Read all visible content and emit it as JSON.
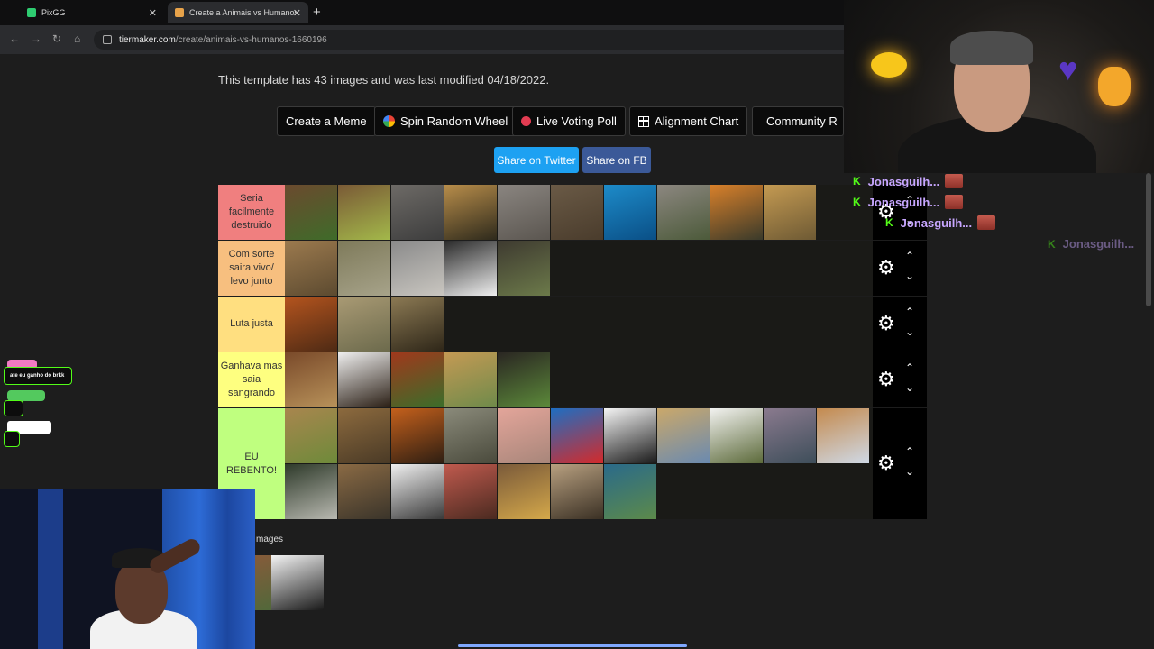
{
  "browser": {
    "tabs": [
      {
        "title": "PixGG",
        "color": "#2ecc71"
      },
      {
        "title": "Create a Animais vs Humanos Tier List",
        "color": "#e8a34a"
      }
    ],
    "url_host": "tiermaker.com",
    "url_path": "/create/animais-vs-humanos-1660196"
  },
  "page": {
    "info_text": "This template has 43 images and was last modified 04/18/2022.",
    "buttons": [
      {
        "label": "Create a Meme"
      },
      {
        "label": "Spin Random Wheel",
        "icon": "wheel-icon"
      },
      {
        "label": "Live Voting Poll",
        "icon": "record-dot-icon"
      },
      {
        "label": "Alignment Chart",
        "icon": "grid-icon"
      },
      {
        "label": "Community R",
        "icon": "community-icon"
      }
    ],
    "share_twitter": "Share on Twitter",
    "share_fb": "Share on FB",
    "tiers": [
      {
        "label": "Seria facilmente destruido",
        "color": "#f07f7f",
        "items": [
          {
            "c1": "#6b4a2e",
            "c2": "#3f6b2a"
          },
          {
            "c1": "#7a5a36",
            "c2": "#a3b84a"
          },
          {
            "c1": "#6d6a66",
            "c2": "#3d3d3d"
          },
          {
            "c1": "#b88d4a",
            "c2": "#2e2a1c"
          },
          {
            "c1": "#8a8580",
            "c2": "#5b5650"
          },
          {
            "c1": "#6a5a46",
            "c2": "#4a3c2c"
          },
          {
            "c1": "#1d8bc9",
            "c2": "#0a4f86"
          },
          {
            "c1": "#8c8780",
            "c2": "#4c5a3a"
          },
          {
            "c1": "#d8802a",
            "c2": "#3a3a2a"
          },
          {
            "c1": "#c49a52",
            "c2": "#6e5a34"
          }
        ]
      },
      {
        "label": "Com sorte saira vivo/ levo junto",
        "color": "#f7bf7f",
        "items": [
          {
            "c1": "#9c7a4e",
            "c2": "#5c4a30"
          },
          {
            "c1": "#7e7a5a",
            "c2": "#a7a38a"
          },
          {
            "c1": "#8a8a8a",
            "c2": "#c9c6c0"
          },
          {
            "c1": "#2a2a2a",
            "c2": "#efefef"
          },
          {
            "c1": "#3e3a30",
            "c2": "#6c7a4a"
          }
        ]
      },
      {
        "label": "Luta justa",
        "color": "#ffdf80",
        "items": [
          {
            "c1": "#b4541e",
            "c2": "#4e2a14"
          },
          {
            "c1": "#a99a74",
            "c2": "#6c6a4c"
          },
          {
            "c1": "#8c7a54",
            "c2": "#2e2618"
          }
        ]
      },
      {
        "label": "Ganhava mas saia sangrando",
        "color": "#feff80",
        "items": [
          {
            "c1": "#7a4a2a",
            "c2": "#b8925a"
          },
          {
            "c1": "#efefef",
            "c2": "#2a1e14"
          },
          {
            "c1": "#a0381c",
            "c2": "#3a6e2a"
          },
          {
            "c1": "#c49a54",
            "c2": "#6e8a4a"
          },
          {
            "c1": "#2a2622",
            "c2": "#5c8a3a"
          }
        ]
      },
      {
        "label": "EU REBENTO!",
        "color": "#bfff7f",
        "items": [
          {
            "c1": "#a8864e",
            "c2": "#6e8a3a"
          },
          {
            "c1": "#8c6a3e",
            "c2": "#4a3a26"
          },
          {
            "c1": "#c4601c",
            "c2": "#2e1e12"
          },
          {
            "c1": "#8a8a7a",
            "c2": "#4a4a3c"
          },
          {
            "c1": "#e3a59a",
            "c2": "#a8867a"
          },
          {
            "c1": "#1e6ec2",
            "c2": "#d42a2a"
          },
          {
            "c1": "#f4f4f4",
            "c2": "#1a1a1a"
          },
          {
            "c1": "#caa86a",
            "c2": "#6a8ab0"
          },
          {
            "c1": "#f2f2f0",
            "c2": "#5c6a3a"
          },
          {
            "c1": "#8a7a8e",
            "c2": "#3e4e5a"
          },
          {
            "c1": "#c48a4e",
            "c2": "#cfd9e6"
          },
          {
            "c1": "#2e3a2a",
            "c2": "#b8b8b0"
          },
          {
            "c1": "#8a6a44",
            "c2": "#3a342a"
          },
          {
            "c1": "#f0f0f0",
            "c2": "#3a3a3a"
          },
          {
            "c1": "#c05a4e",
            "c2": "#4a2a20"
          },
          {
            "c1": "#7a5a3a",
            "c2": "#d4a84a"
          },
          {
            "c1": "#b8a080",
            "c2": "#3a3024"
          },
          {
            "c1": "#2a6a8a",
            "c2": "#5c8a4a"
          }
        ]
      }
    ],
    "untiered_label": "mages",
    "pool": [
      {
        "c1": "#8a5a3a",
        "c2": "#4a6a3a"
      },
      {
        "c1": "#f4f4f4",
        "c2": "#1a1a1a"
      }
    ]
  },
  "stream_chat": [
    {
      "user": "Jonasguilh..."
    },
    {
      "user": "Jonasguilh..."
    },
    {
      "user": "Jonasguilh..."
    },
    {
      "user": "Jonasguilh..."
    }
  ],
  "overlay": {
    "message": "ate eu ganho do brkk"
  }
}
